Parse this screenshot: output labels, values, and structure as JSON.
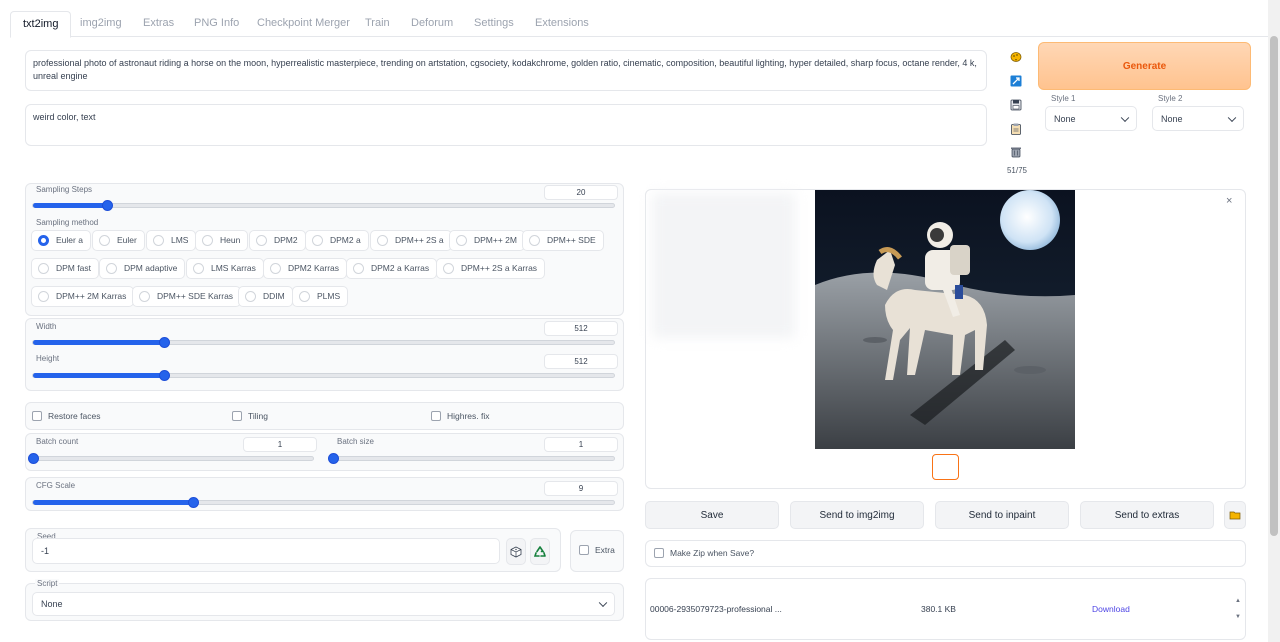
{
  "tabs": [
    "txt2img",
    "img2img",
    "Extras",
    "PNG Info",
    "Checkpoint Merger",
    "Train",
    "Deforum",
    "Settings",
    "Extensions"
  ],
  "active_tab": "txt2img",
  "prompt": "professional photo of astronaut riding a horse on the moon, hyperrealistic masterpiece, trending on artstation, cgsociety, kodakchrome, golden ratio, cinematic, composition, beautiful lighting, hyper detailed, sharp focus, octane render, 4 k, unreal engine",
  "negative_prompt": "weird color, text",
  "token_count": "51/75",
  "generate_label": "Generate",
  "style1": {
    "label": "Style 1",
    "value": "None"
  },
  "style2": {
    "label": "Style 2",
    "value": "None"
  },
  "sampling_steps": {
    "label": "Sampling Steps",
    "value": "20",
    "min": 1,
    "max": 150,
    "current": 20
  },
  "sampling_method": {
    "label": "Sampling method",
    "selected": "Euler a",
    "options": [
      "Euler a",
      "Euler",
      "LMS",
      "Heun",
      "DPM2",
      "DPM2 a",
      "DPM++ 2S a",
      "DPM++ 2M",
      "DPM++ SDE",
      "DPM fast",
      "DPM adaptive",
      "LMS Karras",
      "DPM2 Karras",
      "DPM2 a Karras",
      "DPM++ 2S a Karras",
      "DPM++ 2M Karras",
      "DPM++ SDE Karras",
      "DDIM",
      "PLMS"
    ]
  },
  "width": {
    "label": "Width",
    "value": "512",
    "min": 64,
    "max": 2048,
    "current": 512
  },
  "height": {
    "label": "Height",
    "value": "512",
    "min": 64,
    "max": 2048,
    "current": 512
  },
  "restore_faces": "Restore faces",
  "tiling": "Tiling",
  "highres_fix": "Highres. fix",
  "batch_count": {
    "label": "Batch count",
    "value": "1",
    "min": 1,
    "max": 100,
    "current": 1
  },
  "batch_size": {
    "label": "Batch size",
    "value": "1",
    "min": 1,
    "max": 8,
    "current": 1
  },
  "cfg_scale": {
    "label": "CFG Scale",
    "value": "9",
    "min": 1,
    "max": 30,
    "current": 9
  },
  "seed": {
    "label": "Seed",
    "value": "-1"
  },
  "extra_label": "Extra",
  "script": {
    "label": "Script",
    "value": "None"
  },
  "actions": {
    "save": "Save",
    "send_img2img": "Send to img2img",
    "send_inpaint": "Send to inpaint",
    "send_extras": "Send to extras"
  },
  "make_zip": "Make Zip when Save?",
  "file": {
    "name": "00006-2935079723-professional ...",
    "size": "380.1 KB",
    "download": "Download"
  },
  "colors": {
    "accent": "#2563eb",
    "generate_bg": "#ffc38f",
    "generate_text": "#ea580c"
  }
}
